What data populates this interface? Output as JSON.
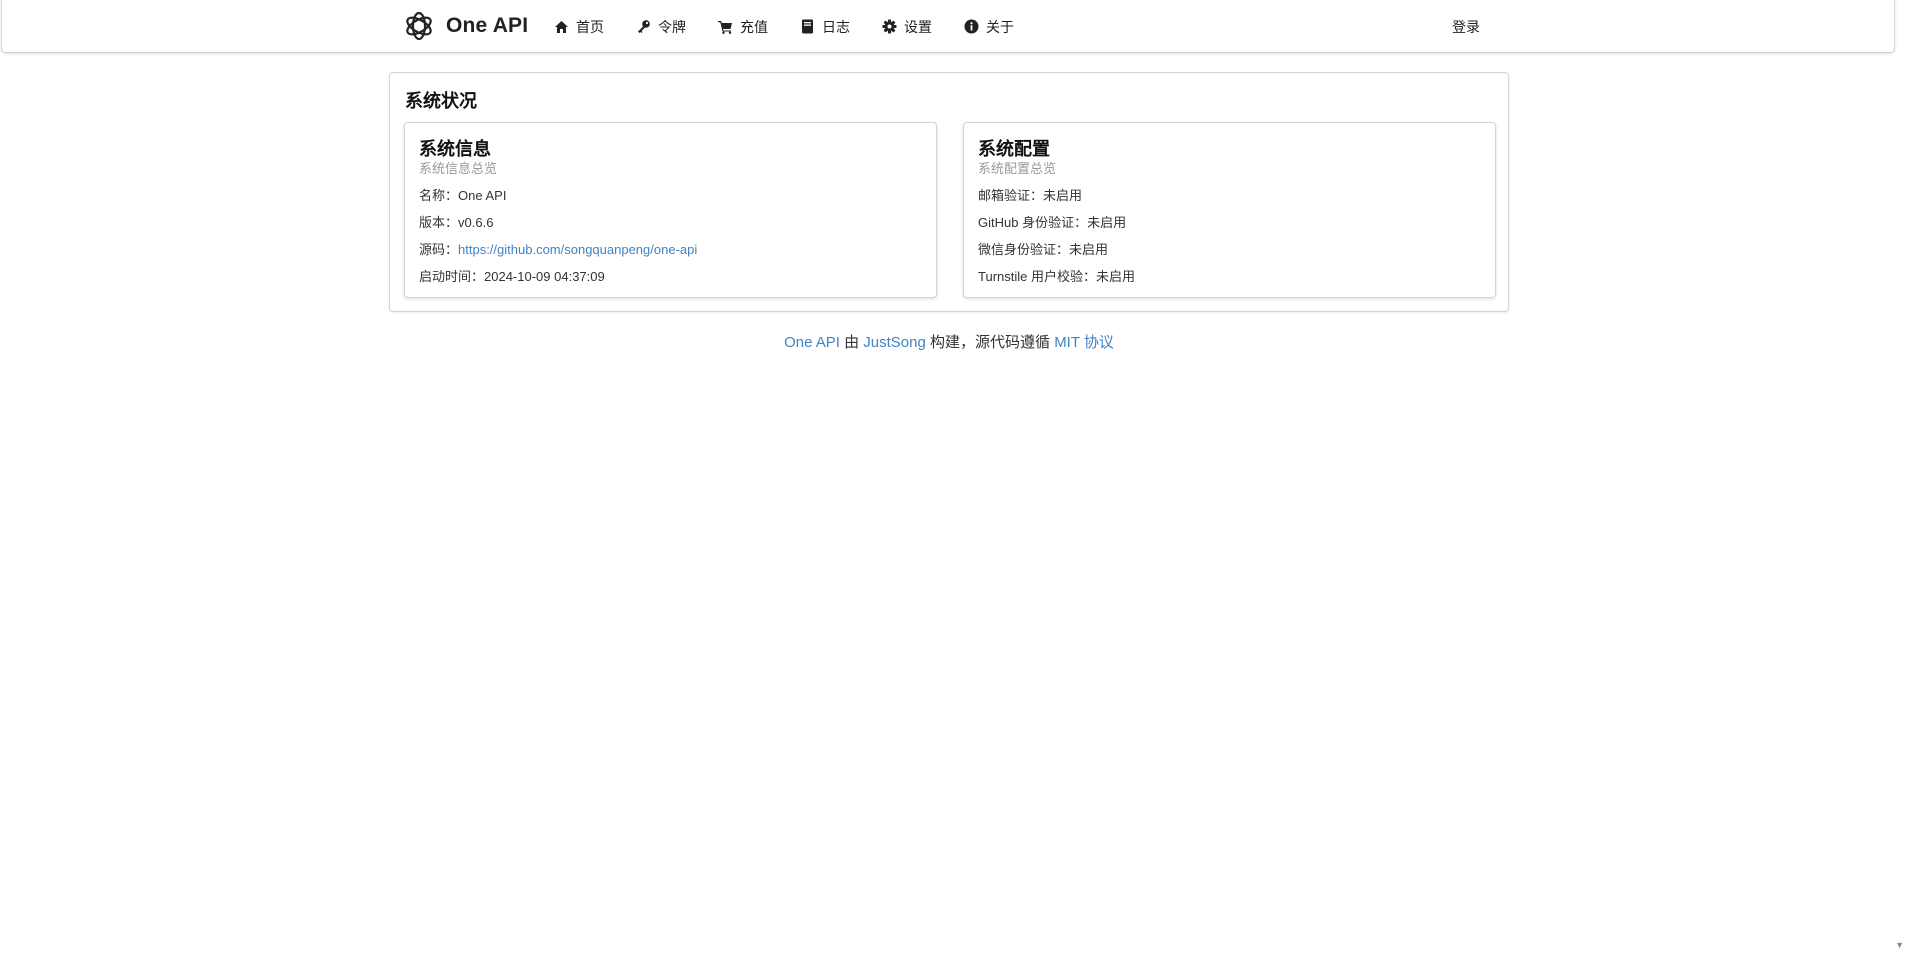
{
  "header": {
    "brand": "One API",
    "nav": [
      {
        "label": "首页",
        "icon": "home-icon"
      },
      {
        "label": "令牌",
        "icon": "key-icon"
      },
      {
        "label": "充值",
        "icon": "cart-icon"
      },
      {
        "label": "日志",
        "icon": "book-icon"
      },
      {
        "label": "设置",
        "icon": "gear-icon"
      },
      {
        "label": "关于",
        "icon": "info-icon"
      }
    ],
    "login": "登录"
  },
  "status": {
    "title": "系统状况",
    "info": {
      "title": "系统信息",
      "subtitle": "系统信息总览",
      "name_label": "名称：",
      "name_value": "One API",
      "version_label": "版本：",
      "version_value": "v0.6.6",
      "source_label": "源码：",
      "source_value": "https://github.com/songquanpeng/one-api",
      "start_label": "启动时间：",
      "start_value": "2024-10-09 04:37:09"
    },
    "config": {
      "title": "系统配置",
      "subtitle": "系统配置总览",
      "rows": [
        {
          "label": "邮箱验证：",
          "value": "未启用"
        },
        {
          "label": "GitHub 身份验证：",
          "value": "未启用"
        },
        {
          "label": "微信身份验证：",
          "value": "未启用"
        },
        {
          "label": "Turnstile 用户校验：",
          "value": "未启用"
        }
      ]
    }
  },
  "footer": {
    "project_link": "One API",
    "by": " 由 ",
    "author_link": "JustSong",
    "built": " 构建，源代码遵循 ",
    "license_link": "MIT 协议"
  },
  "colors": {
    "link": "#4183c4",
    "border": "#d4d4d5",
    "muted": "#999999"
  }
}
